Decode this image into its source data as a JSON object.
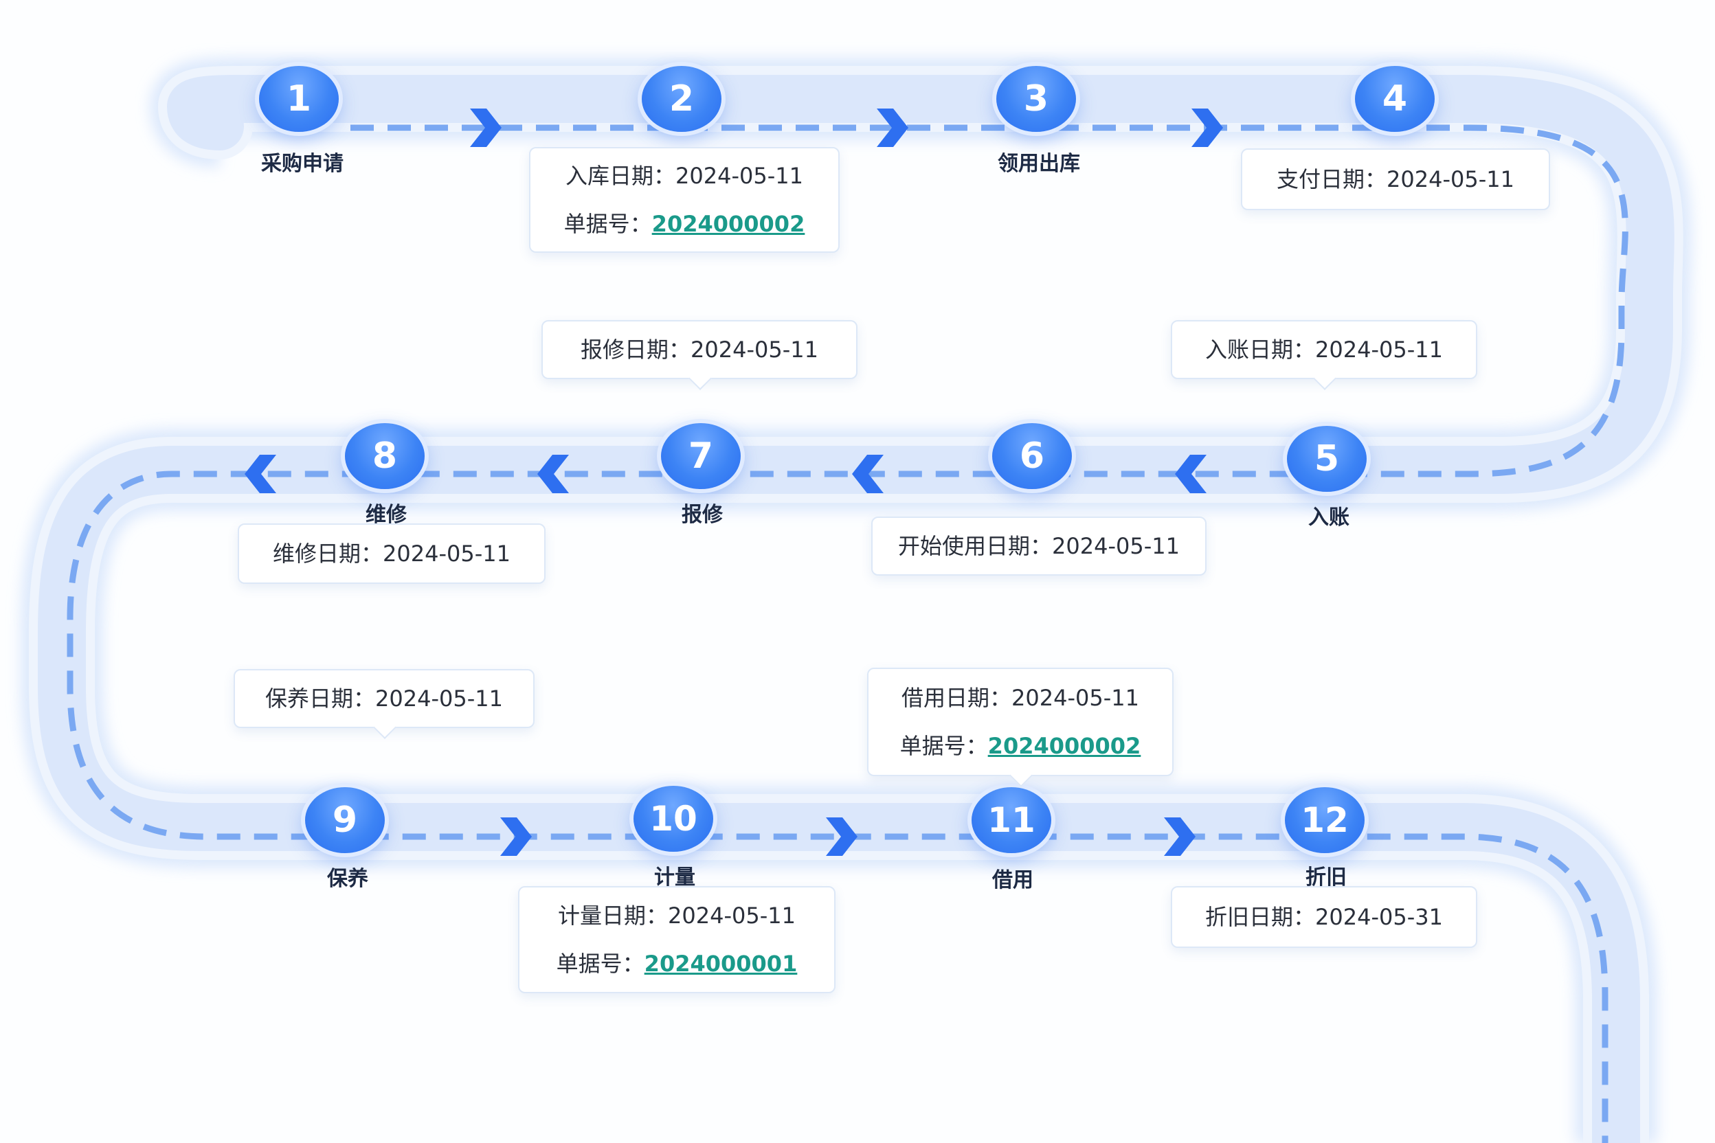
{
  "steps": [
    {
      "num": "1",
      "label": "采购申请"
    },
    {
      "num": "2",
      "label": "入库",
      "date_label": "入库日期：",
      "date": "2024-05-11",
      "doc_label": "单据号：",
      "doc": "2024000002"
    },
    {
      "num": "3",
      "label": "领用出库"
    },
    {
      "num": "4",
      "label": "支付",
      "date_label": "支付日期：",
      "date": "2024-05-11"
    },
    {
      "num": "5",
      "label": "入账",
      "date_label": "入账日期：",
      "date": "2024-05-11"
    },
    {
      "num": "6",
      "label": "开始使用",
      "date_label": "开始使用日期：",
      "date": "2024-05-11"
    },
    {
      "num": "7",
      "label": "报修",
      "date_label": "报修日期：",
      "date": "2024-05-11"
    },
    {
      "num": "8",
      "label": "维修",
      "date_label": "维修日期：",
      "date": "2024-05-11"
    },
    {
      "num": "9",
      "label": "保养",
      "date_label": "保养日期：",
      "date": "2024-05-11"
    },
    {
      "num": "10",
      "label": "计量",
      "date_label": "计量日期：",
      "date": "2024-05-11",
      "doc_label": "单据号：",
      "doc": "2024000001"
    },
    {
      "num": "11",
      "label": "借用",
      "date_label": "借用日期：",
      "date": "2024-05-11",
      "doc_label": "单据号：",
      "doc": "2024000002"
    },
    {
      "num": "12",
      "label": "折旧",
      "date_label": "折旧日期：",
      "date": "2024-05-31"
    }
  ],
  "colors": {
    "road": "#dbe7fb",
    "road_edge": "#eef4fd",
    "dash": "#7aa8f2",
    "chevron": "#2e6ff0",
    "node": "#3d84f5",
    "link": "#1a9a8a"
  }
}
